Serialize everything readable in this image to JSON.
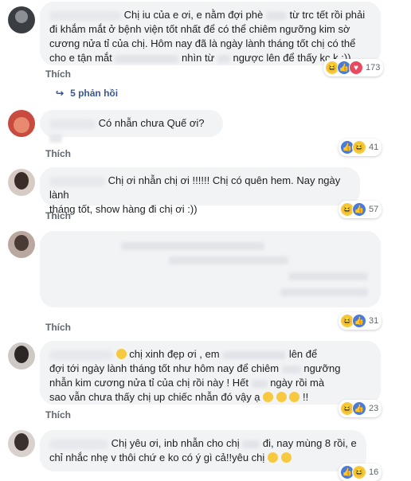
{
  "like_label": "Thích",
  "replies_label": "5 phản hồi",
  "comments": [
    {
      "line1": "Chị iu của e ơi, e nằm đợi phè",
      "line1b": "từ trc tết rồi phải",
      "line2": "đi khắm mắt ở bệnh viện tốt nhất để có thể chiêm ngưỡng kim sờ",
      "line3": "cương nửa tỉ của chị. Hôm nay đã là ngày lành tháng tốt chị có thể",
      "line4a": "cho e tận mắt",
      "line4b": "nhìn từ",
      "line4c": "ngược lên để thấy kc k :))",
      "count": "173"
    },
    {
      "line1": "Có nhẫn chưa Quế ơi?",
      "count": "41"
    },
    {
      "line1": "Chị ơi nhẫn chị ơi !!!!!! Chị có quên hem. Nay ngày lành",
      "line2": "tháng tốt, show hàng đi chị ơi :))",
      "count": "57"
    },
    {
      "count": "31"
    },
    {
      "line1a": "chị xinh đẹp ơi , em",
      "line1b": "lên để",
      "line2a": "đợi tới ngày lành tháng tốt như hôm nay để chiêm",
      "line2b": "ngưỡng",
      "line3": "nhẫn kim cương nửa tỉ của chị rồi này ! Hết",
      "line3b": "ngày rồi mà",
      "line4": "sao vẫn chưa thấy chị up chiếc nhẫn đó vậy ạ",
      "line4b": "!!",
      "count": "23"
    },
    {
      "line1a": "Chị yêu ơi, inb nhẫn cho chị",
      "line1b": "đi, nay mùng 8 rồi, e",
      "line2": "chỉ nhắc nhẹ v thôi chứ e ko có ý gì cả!!yêu chị",
      "count": "16"
    }
  ]
}
